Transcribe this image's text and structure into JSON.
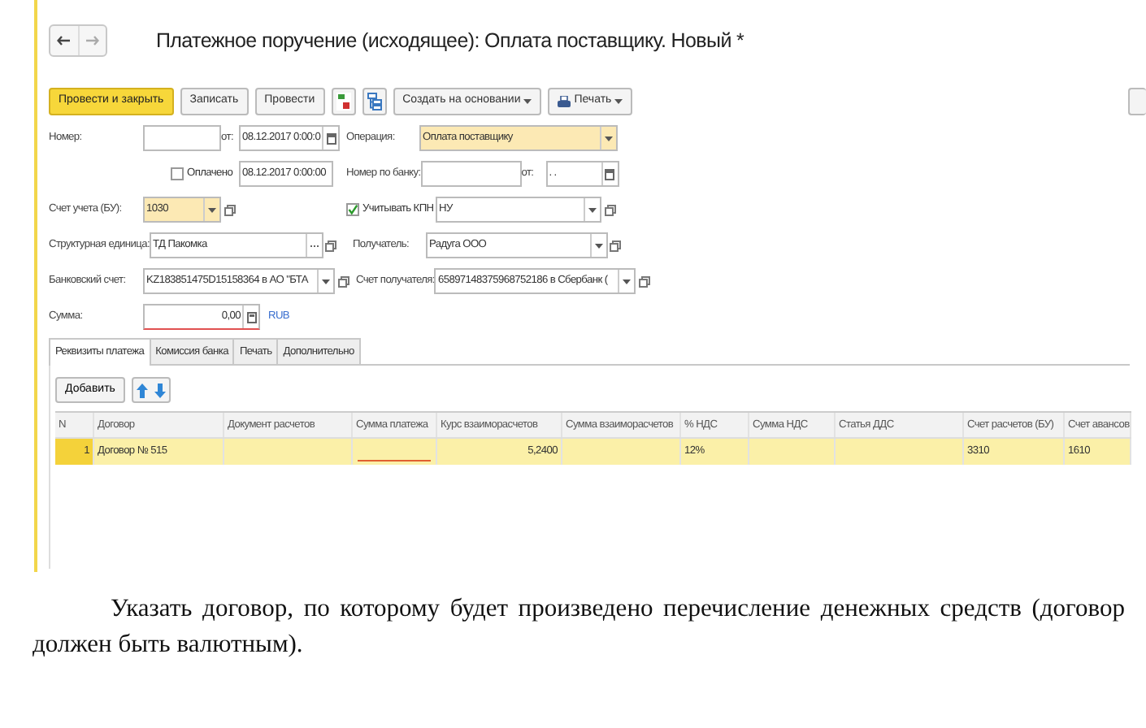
{
  "window": {
    "title": "Платежное поручение (исходящее): Оплата поставщику. Новый *"
  },
  "toolbar": {
    "buttons": [
      {
        "kind": "primary",
        "label": "Провести и закрыть"
      },
      {
        "kind": "plain",
        "label": "Записать"
      },
      {
        "kind": "plain",
        "label": "Провести"
      },
      {
        "kind": "ledger"
      },
      {
        "kind": "structure"
      },
      {
        "kind": "menu",
        "label": "Создать на основании"
      },
      {
        "kind": "print",
        "label": "Печать"
      },
      {
        "kind": "edge"
      }
    ]
  },
  "form": {
    "rows": [
      {
        "items": [
          {
            "kind": "label",
            "text": "Номер:"
          },
          {
            "kind": "input"
          },
          {
            "kind": "label",
            "text": "от:"
          },
          {
            "kind": "date",
            "value": "08.12.2017 0:00:0"
          },
          {
            "kind": "label",
            "text": "Операция:"
          },
          {
            "kind": "select",
            "value": "Оплата поставщику",
            "highlighted": true
          }
        ]
      },
      {
        "items": [
          {
            "kind": "checkbox",
            "label": "Оплачено",
            "checked": false
          },
          {
            "kind": "text-field",
            "value": "08.12.2017 0:00:00"
          },
          {
            "kind": "label",
            "text": "Номер по банку:"
          },
          {
            "kind": "input"
          },
          {
            "kind": "label",
            "text": "от:"
          },
          {
            "kind": "date",
            "value": ". ."
          }
        ]
      },
      {
        "items": [
          {
            "kind": "label",
            "text": "Счет учета (БУ):"
          },
          {
            "kind": "select-open",
            "value": "1030",
            "highlighted": true
          },
          {
            "kind": "checkbox",
            "label": "Учитывать КПН",
            "checked": true
          },
          {
            "kind": "select-open",
            "value": "НУ",
            "highlighted": false
          }
        ]
      },
      {
        "items": [
          {
            "kind": "label",
            "text": "Структурная единица:"
          },
          {
            "kind": "choice-open",
            "value": "ТД Пакомка"
          },
          {
            "kind": "label",
            "text": "Получатель:"
          },
          {
            "kind": "select-open",
            "value": "Радуга ООО",
            "highlighted": false
          }
        ]
      },
      {
        "items": [
          {
            "kind": "label",
            "text": "Банковский счет:"
          },
          {
            "kind": "select-open",
            "value": "KZ183851475D15158364 в АО \"БТА",
            "highlighted": false
          },
          {
            "kind": "label",
            "text": "Счет получателя:"
          },
          {
            "kind": "select-open",
            "value": "65897148375968752186 в Сбербанк (",
            "highlighted": false
          }
        ]
      },
      {
        "items": [
          {
            "kind": "label",
            "text": "Сумма:"
          },
          {
            "kind": "number",
            "value": "0,00",
            "invalid": true
          },
          {
            "kind": "link",
            "text": "RUB"
          }
        ]
      }
    ]
  },
  "tabs": [
    {
      "label": "Реквизиты платежа",
      "selected": true
    },
    {
      "label": "Комиссия банка",
      "selected": false
    },
    {
      "label": "Печать",
      "selected": false
    },
    {
      "label": "Дополнительно",
      "selected": false
    }
  ],
  "table_toolbar": {
    "add_button": "Добавить"
  },
  "table": {
    "columns": [
      {
        "label": "N",
        "required": false
      },
      {
        "label": "Договор",
        "required": false
      },
      {
        "label": "Документ расчетов",
        "required": false
      },
      {
        "label": "Сумма платежа",
        "required": true
      },
      {
        "label": "Курс взаиморасчетов",
        "required": false
      },
      {
        "label": "Сумма взаиморасчетов",
        "required": false
      },
      {
        "label": "% НДС",
        "required": false
      },
      {
        "label": "Сумма НДС",
        "required": false
      },
      {
        "label": "Статья ДДС",
        "required": false
      },
      {
        "label": "Счет расчетов (БУ)",
        "required": false
      },
      {
        "label": "Счет авансов",
        "required": false
      }
    ],
    "rows": [
      {
        "selected": true,
        "cells": [
          "1",
          "Договор № 515",
          null,
          null,
          "5,2400",
          null,
          "12%",
          null,
          null,
          "3310",
          "1610"
        ]
      }
    ]
  },
  "caption": "Указать договор, по которому будет произведено перечисление денежных средств (договор должен быть валютным)."
}
